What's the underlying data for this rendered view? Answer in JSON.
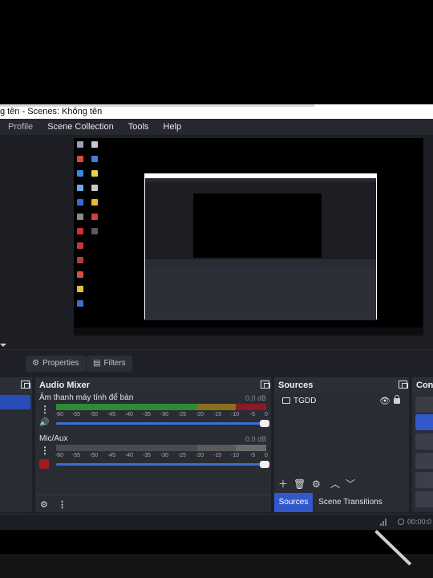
{
  "window": {
    "title": "g tên - Scenes: Không tên"
  },
  "menu": {
    "items": [
      "Profile",
      "Scene Collection",
      "Tools",
      "Help"
    ]
  },
  "toolbar": {
    "properties_label": "Properties",
    "filters_label": "Filters"
  },
  "audio_mixer": {
    "title": "Audio Mixer",
    "channels": [
      {
        "name": "Âm thanh máy tính để bàn",
        "db": "0.0 dB",
        "muted": false
      },
      {
        "name": "Mic/Aux",
        "db": "0.0 dB",
        "muted": true
      }
    ],
    "ticks": [
      "-60",
      "-55",
      "-50",
      "-45",
      "-40",
      "-35",
      "-30",
      "-25",
      "-20",
      "-15",
      "-10",
      "-5",
      "0"
    ]
  },
  "sources": {
    "title": "Sources",
    "items": [
      {
        "name": "TGDD",
        "visible": true,
        "locked": true
      }
    ]
  },
  "tabs": {
    "sources": "Sources",
    "scene_transitions": "Scene Transitions"
  },
  "controls": {
    "title": "Cont"
  },
  "status": {
    "time": "00:00:0"
  },
  "colors": {
    "accent": "#3358c9",
    "panel": "#2a2c34",
    "background": "#1f2027",
    "meter_green": "#2f8a34",
    "meter_yellow": "#b08a1e",
    "meter_red": "#a0202c"
  }
}
